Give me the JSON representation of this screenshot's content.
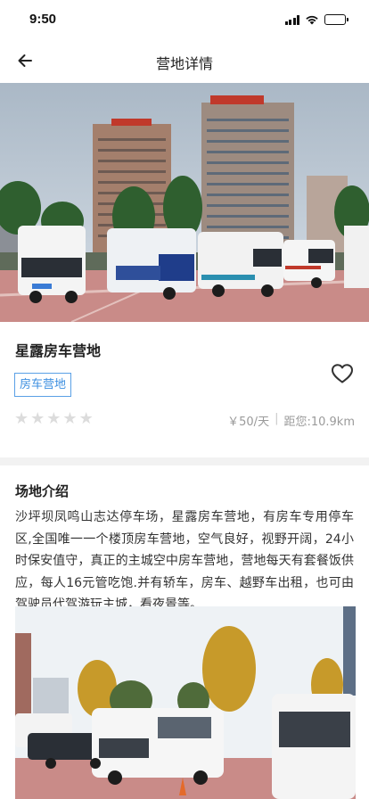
{
  "status": {
    "time": "9:50"
  },
  "header": {
    "title": "营地详情",
    "back_icon": "arrow-left-icon"
  },
  "camp": {
    "name": "星露房车营地",
    "tag": "房车营地",
    "rating": 0,
    "rating_max": 5,
    "price": "￥50/天",
    "distance": "距您:10.9km",
    "favorite_icon": "heart-outline-icon"
  },
  "intro": {
    "title": "场地介绍",
    "text": "沙坪坝凤鸣山志达停车场，星露房车营地，有房车专用停车区,全国唯一一个楼顶房车营地，空气良好，视野开阔，24小时保安值守，真正的主城空中房车营地，营地每天有套餐饭供应，每人16元管吃饱.并有轿车，房车、越野车出租，也可由驾驶员代驾游玩主城，看夜景等。"
  },
  "colors": {
    "accent": "#3d8fe0",
    "star_inactive": "#dcdcdc",
    "meta_text": "#9a9a9a"
  }
}
